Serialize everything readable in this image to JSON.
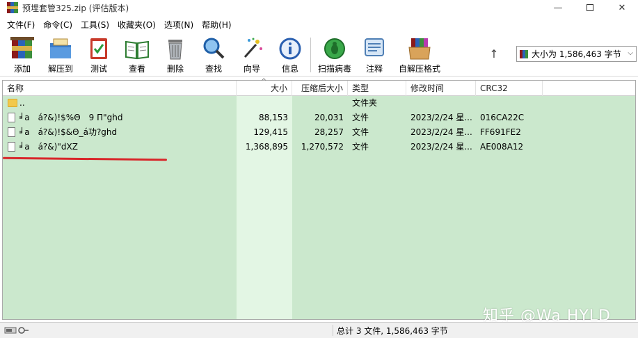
{
  "window": {
    "title": "预埋套管325.zip (评估版本)",
    "min_glyph": "—",
    "close_glyph": "✕"
  },
  "menu": [
    "文件(F)",
    "命令(C)",
    "工具(S)",
    "收藏夹(O)",
    "选项(N)",
    "帮助(H)"
  ],
  "toolbar": {
    "buttons": [
      {
        "label": "添加",
        "icon": "add-archive-icon"
      },
      {
        "label": "解压到",
        "icon": "extract-to-icon"
      },
      {
        "label": "测试",
        "icon": "test-archive-icon"
      },
      {
        "label": "查看",
        "icon": "view-book-icon"
      },
      {
        "label": "删除",
        "icon": "delete-trash-icon"
      },
      {
        "label": "查找",
        "icon": "find-magnifier-icon"
      },
      {
        "label": "向导",
        "icon": "wizard-wand-icon"
      },
      {
        "label": "信息",
        "icon": "info-icon"
      },
      {
        "label": "扫描病毒",
        "icon": "virus-scan-icon"
      },
      {
        "label": "注释",
        "icon": "comment-icon"
      },
      {
        "label": "自解压格式",
        "icon": "sfx-box-icon"
      }
    ],
    "up_glyph": "↑",
    "combo_text": "大小为 1,586,463 字节",
    "combo_arrow": "⌵"
  },
  "list": {
    "columns": [
      "名称",
      "大小",
      "压缩后大小",
      "类型",
      "修改时间",
      "CRC32"
    ],
    "sort_glyph": "^",
    "rows": [
      {
        "name": "..",
        "size": "",
        "packed": "",
        "type": "文件夹",
        "modified": "",
        "crc": "",
        "kind": "folder"
      },
      {
        "name": "╛a　á?&)!$%Θ　9 Π\"ghd",
        "size": "88,153",
        "packed": "20,031",
        "type": "文件",
        "modified": "2023/2/24 星...",
        "crc": "016CA22C",
        "kind": "file"
      },
      {
        "name": "╛a　á?&)!$&Θ_á功?ghd",
        "size": "129,415",
        "packed": "28,257",
        "type": "文件",
        "modified": "2023/2/24 星...",
        "crc": "FF691FE2",
        "kind": "file"
      },
      {
        "name": "╛a　á?&)\"dXZ",
        "size": "1,368,895",
        "packed": "1,270,572",
        "type": "文件",
        "modified": "2023/2/24 星...",
        "crc": "AE008A12",
        "kind": "file"
      }
    ]
  },
  "status": {
    "summary": "总计 3 文件, 1,586,463 字节"
  },
  "watermark": "知乎 @Wa HYLD",
  "colors": {
    "list_bg": "#cbe8cd",
    "size_column_bg": "#e3f6e4",
    "annotation_red": "#d8262a"
  }
}
